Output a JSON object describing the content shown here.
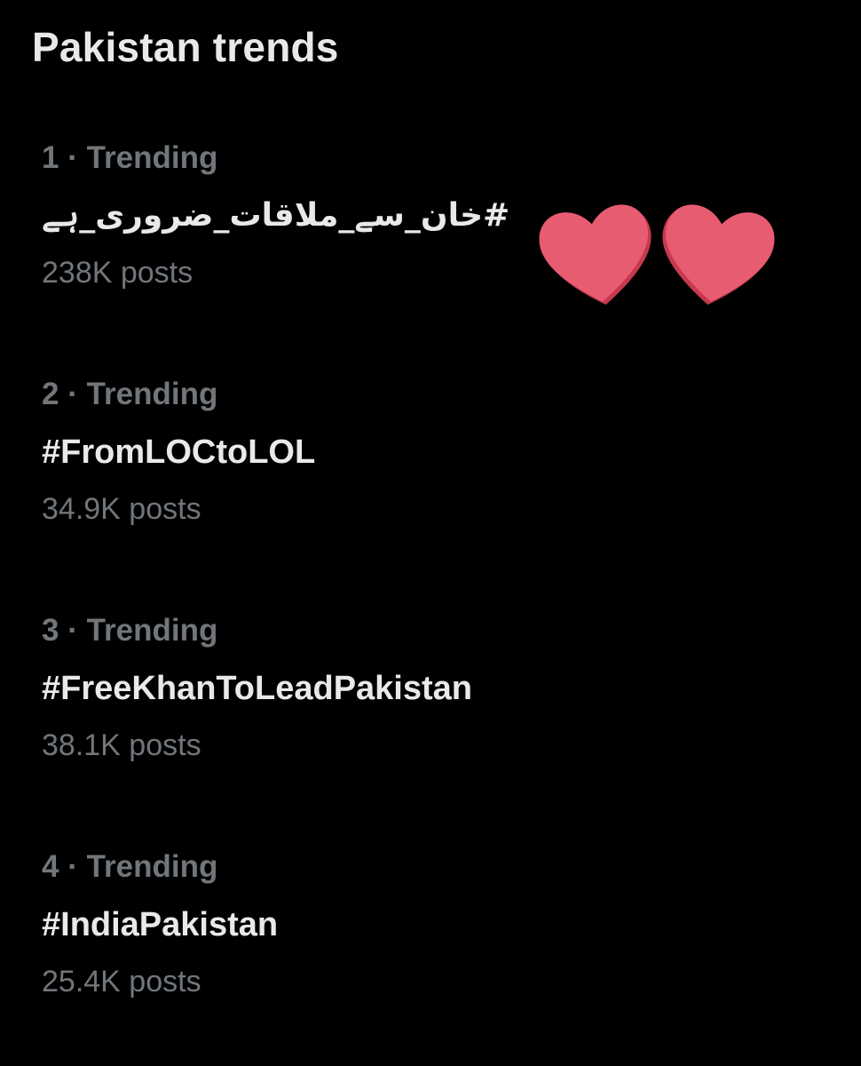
{
  "header": {
    "title": "Pakistan trends"
  },
  "trends": [
    {
      "meta": "1 · Trending",
      "name": "#خان_سے_ملاقات_ضروری_ہے",
      "posts": "238K posts"
    },
    {
      "meta": "2 · Trending",
      "name": "#FromLOCtoLOL",
      "posts": "34.9K posts"
    },
    {
      "meta": "3 · Trending",
      "name": "#FreeKhanToLeadPakistan",
      "posts": "38.1K posts"
    },
    {
      "meta": "4 · Trending",
      "name": "#IndiaPakistan",
      "posts": "25.4K posts"
    }
  ],
  "decorations": {
    "hearts_icon": "two-hearts-emoji",
    "heart_color": "#e85c72",
    "heart_shadow_color": "#c7394f"
  },
  "colors": {
    "background": "#000000",
    "primary_text": "#e7e9ea",
    "secondary_text": "#71767b"
  }
}
